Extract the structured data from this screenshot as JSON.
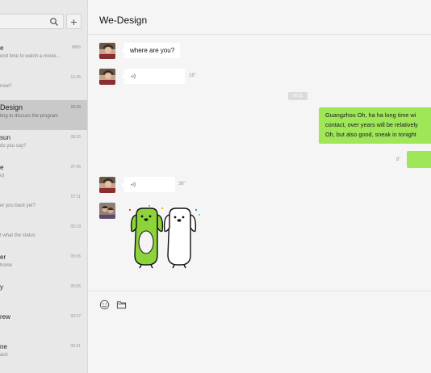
{
  "sidebar": {
    "add_label": "+",
    "items": [
      {
        "name": "e",
        "preview": "end time to watch a movie...",
        "time": "8866",
        "selected": false
      },
      {
        "name": "",
        "preview": "now?",
        "time": "12:45",
        "selected": false
      },
      {
        "name": "Design",
        "preview": "ting to discuss the program",
        "time": "10:15",
        "selected": true
      },
      {
        "name": "sun",
        "preview": "do you say?",
        "time": "08:35",
        "selected": false
      },
      {
        "name": "e",
        "preview": "o)",
        "time": "07:45",
        "selected": false
      },
      {
        "name": "",
        "preview": "er you back yet?",
        "time": "07:11",
        "selected": false
      },
      {
        "name": "",
        "preview": "t what the status",
        "time": "05:18",
        "selected": false
      },
      {
        "name": "er",
        "preview": "home",
        "time": "05:06",
        "selected": false
      },
      {
        "name": "y",
        "preview": "",
        "time": "00:06",
        "selected": false
      },
      {
        "name": "rew",
        "preview": "",
        "time": "00:07",
        "selected": false
      },
      {
        "name": "ne",
        "preview": "ach",
        "time": "00:01",
        "selected": false
      }
    ]
  },
  "chat": {
    "title": "We-Design",
    "messages": [
      {
        "text": "where are you?"
      },
      {
        "duration": "16\""
      },
      {
        "timestamp": "00:11"
      },
      {
        "lines": [
          "Guangzhou Oh, ha ha long time wi",
          "contact, over years will be relatively",
          "Oh, but also good, sneak in tonight"
        ]
      },
      {
        "duration": "8\""
      },
      {
        "duration": "36\""
      }
    ]
  },
  "colors": {
    "sent_bubble": "#9fe658",
    "received_bubble": "#ffffff",
    "sidebar_bg": "#e8e8e8",
    "selected_item": "#c9c9c9"
  }
}
